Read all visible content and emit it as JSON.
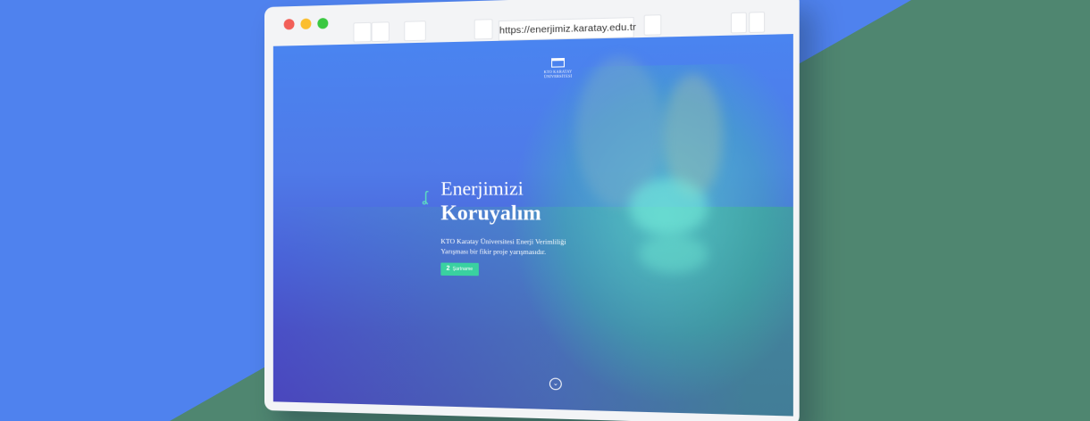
{
  "browser": {
    "url": "https://enerjimiz.karatay.edu.tr",
    "traffic_lights": {
      "close": "#f25f58",
      "minimize": "#fbbe2e",
      "maximize": "#39c840"
    }
  },
  "site": {
    "logo_text": "KTO KARATAY ÜNİVERSİTESİ",
    "hero": {
      "title_line1": "Enerjimizi",
      "title_line2": "Koruyalım",
      "description": "KTO Karatay Üniversitesi Enerji Verimliliği Yarışması bir fikir proje yarışmasıdır.",
      "cta_number": "2",
      "cta_label": "Şartname"
    },
    "scroll_icon": "chevron-down-icon"
  },
  "colors": {
    "background_blue": "#4f82ee",
    "background_green": "#4f8670",
    "accent_teal": "#3ad1a0"
  }
}
